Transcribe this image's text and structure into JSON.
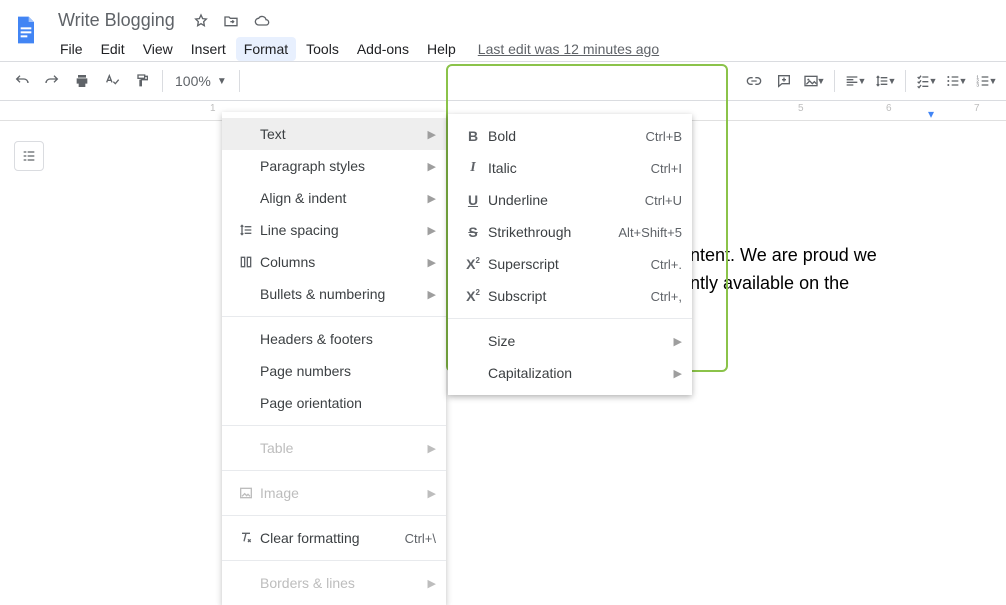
{
  "header": {
    "doc_title": "Write Blogging",
    "last_edit": "Last edit was 12 minutes ago"
  },
  "menubar": {
    "file": "File",
    "edit": "Edit",
    "view": "View",
    "insert": "Insert",
    "format": "Format",
    "tools": "Tools",
    "addons": "Add-ons",
    "help": "Help"
  },
  "toolbar": {
    "zoom": "100%"
  },
  "ruler": {
    "n1": "1",
    "n5": "5",
    "n6": "6",
    "n7": "7"
  },
  "format_menu": {
    "text": "Text",
    "paragraph_styles": "Paragraph styles",
    "align_indent": "Align & indent",
    "line_spacing": "Line spacing",
    "columns": "Columns",
    "bullets_numbering": "Bullets & numbering",
    "headers_footers": "Headers & footers",
    "page_numbers": "Page numbers",
    "page_orientation": "Page orientation",
    "table": "Table",
    "image": "Image",
    "clear_formatting": "Clear formatting",
    "clear_formatting_shortcut": "Ctrl+\\",
    "borders_lines": "Borders & lines"
  },
  "text_submenu": {
    "bold": "Bold",
    "bold_sc": "Ctrl+B",
    "italic": "Italic",
    "italic_sc": "Ctrl+I",
    "underline": "Underline",
    "underline_sc": "Ctrl+U",
    "strikethrough": "Strikethrough",
    "strikethrough_sc": "Alt+Shift+5",
    "superscript": "Superscript",
    "superscript_sc": "Ctrl+.",
    "subscript": "Subscript",
    "subscript_sc": "Ctrl+,",
    "size": "Size",
    "capitalization": "Capitalization"
  },
  "document": {
    "line1_frag": "ntent. We are proud we",
    "line2_frag": "ntly available on the"
  }
}
